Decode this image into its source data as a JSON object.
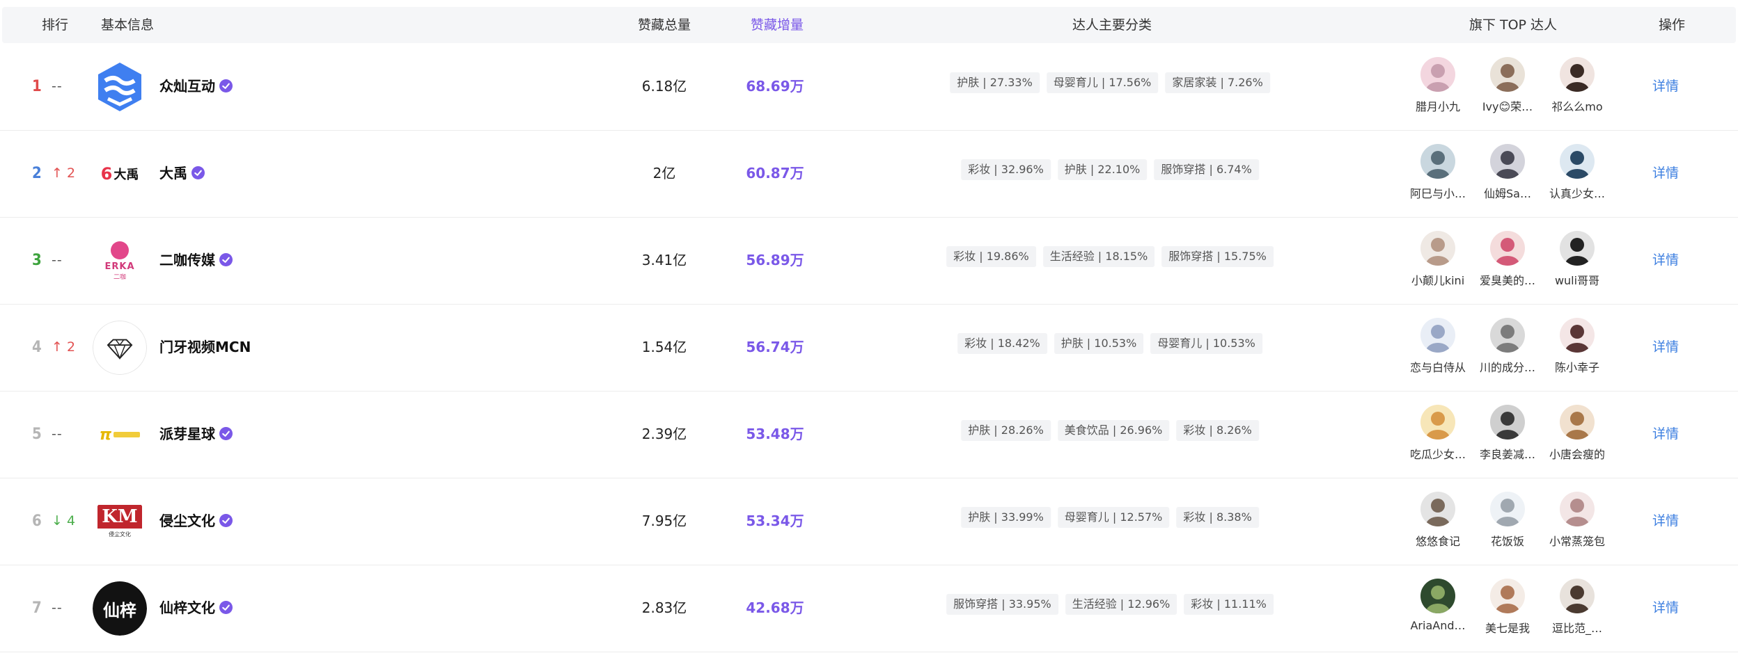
{
  "header": {
    "rank": "排行",
    "basic_info": "基本信息",
    "total_likes": "赞藏总量",
    "likes_increase": "赞藏增量",
    "main_categories": "达人主要分类",
    "top_creators": "旗下 TOP 达人",
    "action": "操作"
  },
  "colors": {
    "accent": "#7a58e8",
    "link": "#3d7fe0",
    "up": "#e25252",
    "down": "#4cae4c"
  },
  "rows": [
    {
      "rank": "1",
      "rank_color": "#e04a4a",
      "change": "--",
      "change_dir": "same",
      "name": "众灿互动",
      "verified": true,
      "logo": "zhongcan-logo",
      "total": "6.18亿",
      "increase": "68.69万",
      "categories": [
        "护肤 | 27.33%",
        "母婴育儿 | 17.56%",
        "家居家装 | 7.26%"
      ],
      "creators": [
        "腊月小九",
        "Ivy😊荣…",
        "祁么么mo"
      ],
      "action": "详情"
    },
    {
      "rank": "2",
      "rank_color": "#4a80d9",
      "change": "2",
      "change_dir": "up",
      "name": "大禹",
      "verified": true,
      "logo": "dayu-logo",
      "logo_text": "大禹",
      "total": "2亿",
      "increase": "60.87万",
      "categories": [
        "彩妆 | 32.96%",
        "护肤 | 22.10%",
        "服饰穿搭 | 6.74%"
      ],
      "creators": [
        "阿巳与小…",
        "仙姆Sa…",
        "认真少女…"
      ],
      "action": "详情"
    },
    {
      "rank": "3",
      "rank_color": "#3ea33e",
      "change": "--",
      "change_dir": "same",
      "name": "二咖传媒",
      "verified": true,
      "logo": "erka-logo",
      "logo_text": "ERKA",
      "total": "3.41亿",
      "increase": "56.89万",
      "categories": [
        "彩妆 | 19.86%",
        "生活经验 | 18.15%",
        "服饰穿搭 | 15.75%"
      ],
      "creators": [
        "小颠儿kini",
        "爱臭美的…",
        "wuli哥哥"
      ],
      "action": "详情"
    },
    {
      "rank": "4",
      "rank_color": "#b5b5b5",
      "change": "2",
      "change_dir": "up",
      "name": "门牙视频MCN",
      "verified": false,
      "logo": "diamond-logo",
      "total": "1.54亿",
      "increase": "56.74万",
      "categories": [
        "彩妆 | 18.42%",
        "护肤 | 10.53%",
        "母婴育儿 | 10.53%"
      ],
      "creators": [
        "恋与白侍从",
        "川的成分…",
        "陈小幸子"
      ],
      "action": "详情"
    },
    {
      "rank": "5",
      "rank_color": "#b5b5b5",
      "change": "--",
      "change_dir": "same",
      "name": "派芽星球",
      "verified": true,
      "logo": "paiya-logo",
      "total": "2.39亿",
      "increase": "53.48万",
      "categories": [
        "护肤 | 28.26%",
        "美食饮品 | 26.96%",
        "彩妆 | 8.26%"
      ],
      "creators": [
        "吃瓜少女…",
        "李良姜减…",
        "小唐会瘦的"
      ],
      "action": "详情"
    },
    {
      "rank": "6",
      "rank_color": "#b5b5b5",
      "change": "4",
      "change_dir": "down",
      "name": "侵尘文化",
      "verified": true,
      "logo": "km-logo",
      "logo_text": "KM",
      "total": "7.95亿",
      "increase": "53.34万",
      "categories": [
        "护肤 | 33.99%",
        "母婴育儿 | 12.57%",
        "彩妆 | 8.38%"
      ],
      "creators": [
        "悠悠食记",
        "花饭饭",
        "小常蒸笼包"
      ],
      "action": "详情"
    },
    {
      "rank": "7",
      "rank_color": "#b5b5b5",
      "change": "--",
      "change_dir": "same",
      "name": "仙梓文化",
      "verified": true,
      "logo": "xianzi-logo",
      "logo_text": "仙梓",
      "total": "2.83亿",
      "increase": "42.68万",
      "categories": [
        "服饰穿搭 | 33.95%",
        "生活经验 | 12.96%",
        "彩妆 | 11.11%"
      ],
      "creators": [
        "AriaAnd…",
        "美七是我",
        "逗比范_…"
      ],
      "action": "详情"
    }
  ]
}
